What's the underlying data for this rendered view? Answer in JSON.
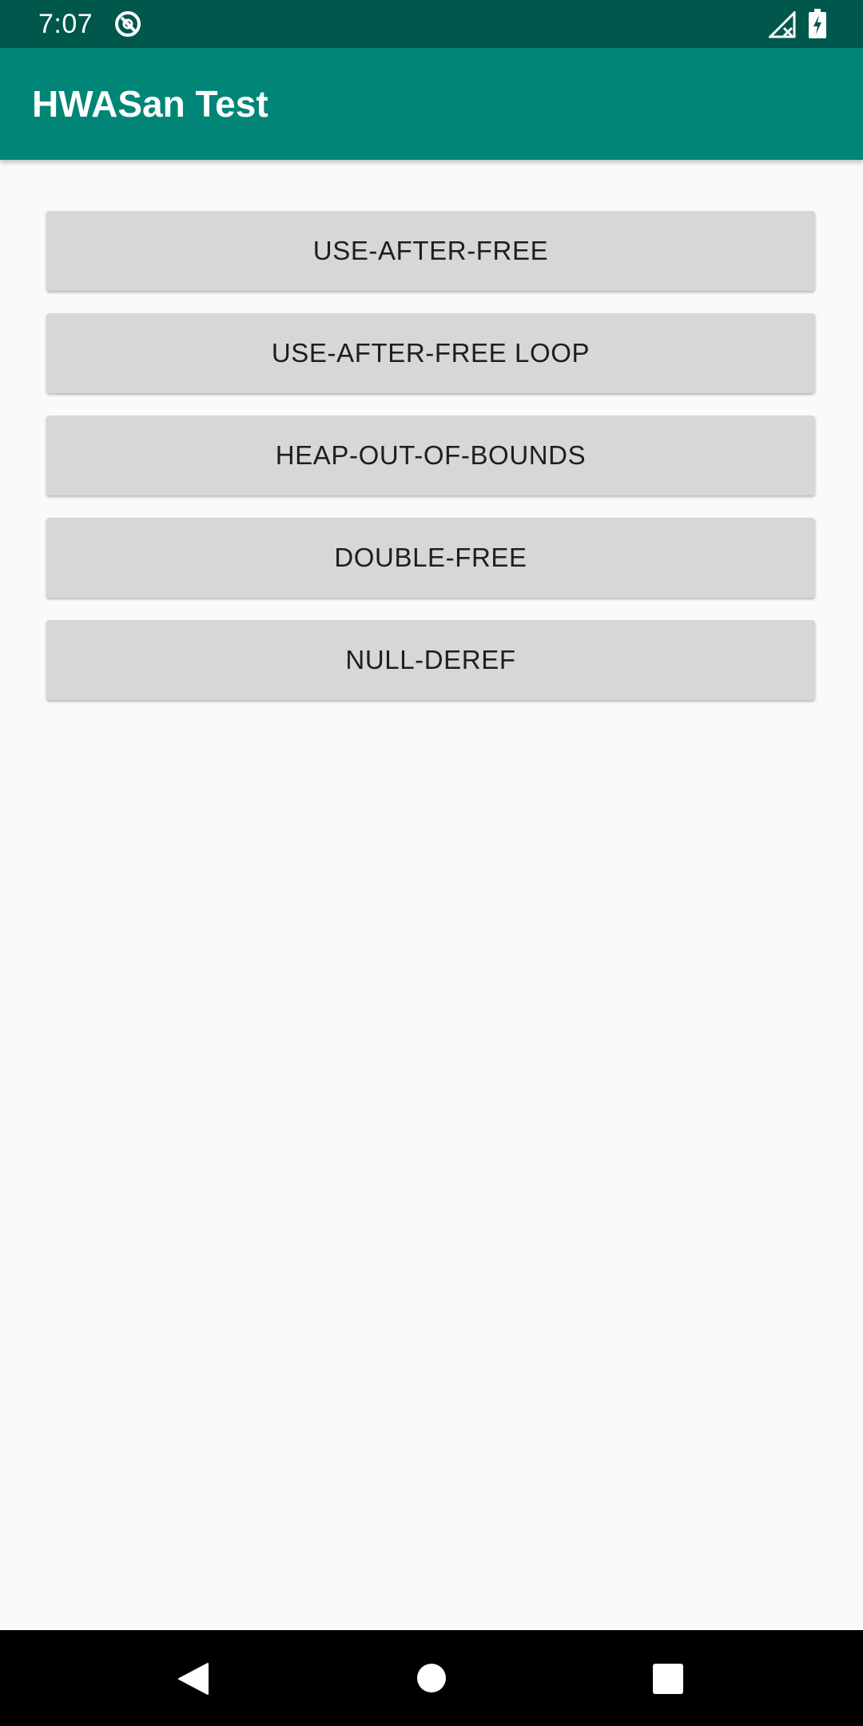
{
  "status_bar": {
    "time": "7:07",
    "left_icon": "sync-disabled-icon",
    "signal_icon": "no-signal-icon",
    "battery_icon": "battery-charging-icon"
  },
  "app_bar": {
    "title": "HWASan Test"
  },
  "buttons": [
    {
      "label": "USE-AFTER-FREE"
    },
    {
      "label": "USE-AFTER-FREE LOOP"
    },
    {
      "label": "HEAP-OUT-OF-BOUNDS"
    },
    {
      "label": "DOUBLE-FREE"
    },
    {
      "label": "NULL-DEREF"
    }
  ],
  "nav_bar": {
    "back_icon": "back-triangle-icon",
    "home_icon": "home-circle-icon",
    "recents_icon": "recents-square-icon"
  },
  "colors": {
    "status_bar": "#00574b",
    "app_bar": "#008577",
    "button_bg": "#d6d7d7",
    "background": "#fafafa"
  }
}
